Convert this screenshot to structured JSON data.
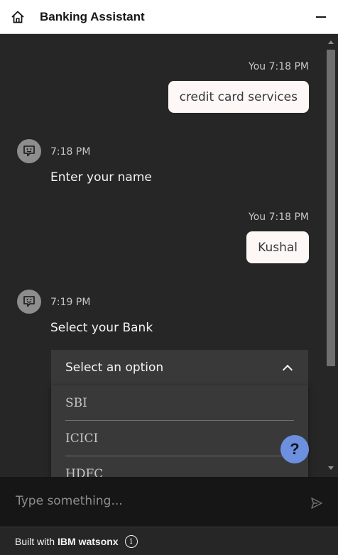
{
  "header": {
    "title": "Banking Assistant",
    "home_icon": "home-icon",
    "minimize_icon": "minimize-icon"
  },
  "messages": [
    {
      "role": "user",
      "meta": "You 7:18 PM",
      "text": "credit card services"
    },
    {
      "role": "bot",
      "time": "7:18 PM",
      "text": "Enter your name"
    },
    {
      "role": "user",
      "meta": "You 7:18 PM",
      "text": "Kushal"
    },
    {
      "role": "bot",
      "time": "7:19 PM",
      "text": "Select your Bank"
    }
  ],
  "dropdown": {
    "selected": "Select an option",
    "expanded": true,
    "options": [
      "SBI",
      "ICICI",
      "HDFC"
    ]
  },
  "help": {
    "label": "?"
  },
  "composer": {
    "placeholder": "Type something..."
  },
  "footer": {
    "prefix": "Built with",
    "brand": "IBM watsonx",
    "info_glyph": "i"
  },
  "colors": {
    "header_bg": "#ffffff",
    "chat_bg": "#262626",
    "user_bubble": "#fdf7f5",
    "accent_help": "#6d8fe0",
    "input_bg": "#161616"
  }
}
